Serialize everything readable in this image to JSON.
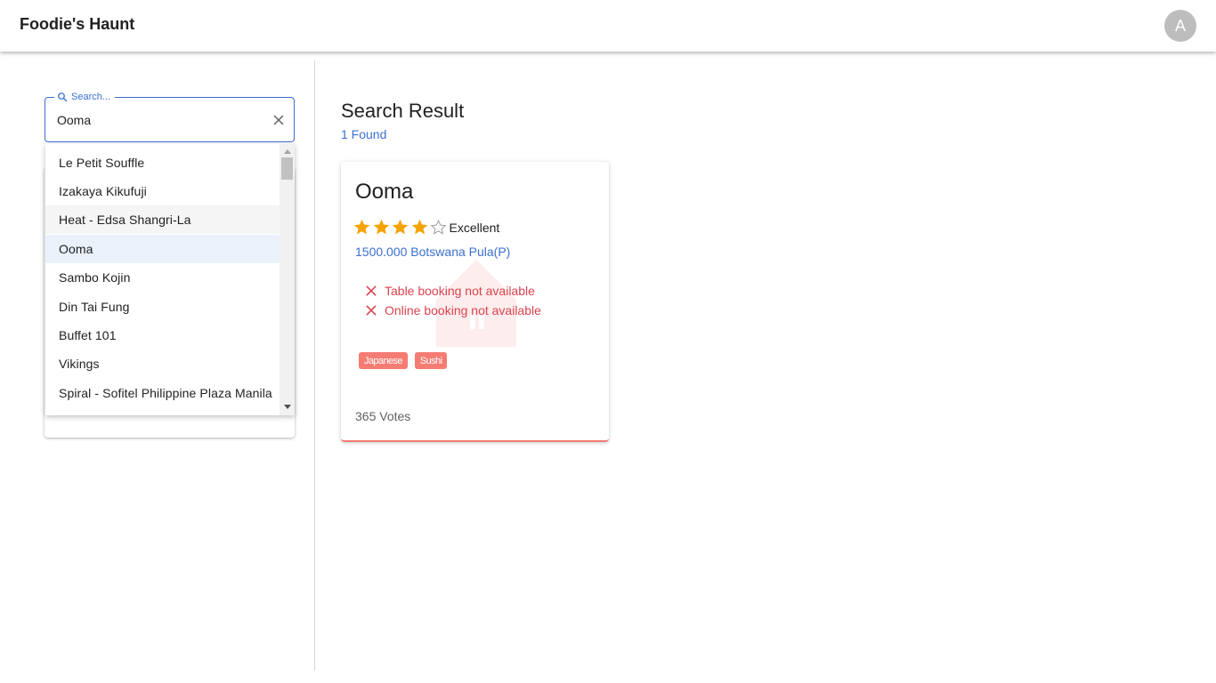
{
  "app": {
    "title": "Foodie's Haunt",
    "avatar_letter": "A"
  },
  "search": {
    "label": "Search...",
    "value": "Ooma"
  },
  "dropdown": {
    "items": [
      "Le Petit Souffle",
      "Izakaya Kikufuji",
      "Heat - Edsa Shangri-La",
      "Ooma",
      "Sambo Kojin",
      "Din Tai Fung",
      "Buffet 101",
      "Vikings",
      "Spiral - Sofitel Philippine Plaza Manila"
    ],
    "hovered_item": "Heat - Edsa Shangri-La",
    "selected_item": "Ooma"
  },
  "results": {
    "title": "Search Result",
    "count_text": "1 Found"
  },
  "card": {
    "name": "Ooma",
    "rating": 4,
    "rating_max": 5,
    "rating_text": "Excellent",
    "price": "1500.000 Botswana Pula(P)",
    "table_booking": "Table booking not available",
    "online_booking": "Online booking not available",
    "tags": [
      "Japanese",
      "Sushi"
    ],
    "votes": "365 Votes"
  },
  "colors": {
    "accent": "#3b6fd1",
    "star": "#f5a300",
    "error": "#d9434f",
    "tag": "#f47c73"
  }
}
